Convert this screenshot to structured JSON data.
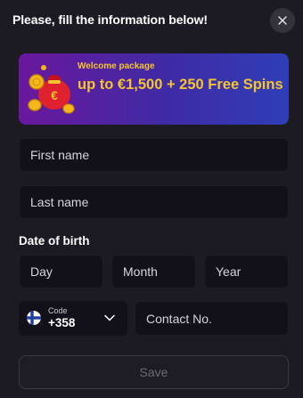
{
  "dialog": {
    "title": "Please, fill the information below!"
  },
  "promo": {
    "subtitle": "Welcome package",
    "headline": "up to €1,500 + 250 Free Spins"
  },
  "form": {
    "first_name_placeholder": "First name",
    "last_name_placeholder": "Last name",
    "dob_label": "Date of birth",
    "day_placeholder": "Day",
    "month_placeholder": "Month",
    "year_placeholder": "Year",
    "phone_code_label": "Code",
    "phone_code_value": "+358",
    "phone_country_icon": "finland-flag-icon",
    "contact_placeholder": "Contact No.",
    "save_label": "Save"
  },
  "colors": {
    "background": "#1c1b24",
    "field_bg": "#121119",
    "promo_text": "#f4c430",
    "promo_gradient_start": "#6a189d",
    "promo_gradient_end": "#2f3eb7",
    "save_text_disabled": "#6b6a73"
  }
}
